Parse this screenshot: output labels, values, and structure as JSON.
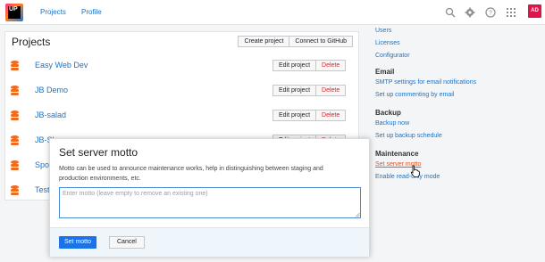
{
  "logo": {
    "text": "UP"
  },
  "nav": {
    "projects": "Projects",
    "profile": "Profile"
  },
  "header_icons": [
    "search-icon",
    "gear-icon",
    "help-icon",
    "apps-grid-icon"
  ],
  "user": {
    "initials": "AD"
  },
  "projects_panel": {
    "title": "Projects",
    "create_label": "Create project",
    "connect_label": "Connect to GitHub",
    "edit_label": "Edit project",
    "delete_label": "Delete",
    "rows": [
      {
        "name": "Easy Web Dev"
      },
      {
        "name": "JB Demo"
      },
      {
        "name": "JB-salad"
      },
      {
        "name": "JB-Show"
      },
      {
        "name": "Spo"
      },
      {
        "name": "Test"
      }
    ]
  },
  "sidebar": {
    "users": "Users",
    "licenses": "Licenses",
    "configurator": "Configurator",
    "email_head": "Email",
    "smtp": "SMTP settings for email notifications",
    "commenting": "Set up commenting by email",
    "backup_head": "Backup",
    "backup_now": "Backup now",
    "backup_schedule": "Set up backup schedule",
    "maintenance_head": "Maintenance",
    "server_motto": "Set server motto",
    "read_only": "Enable read-only mode"
  },
  "modal": {
    "title": "Set server motto",
    "description": "Motto can be used to announce maintenance works, help in distinguishing between staging and production environments, etc.",
    "placeholder": "Enter motto (leave empty to remove an existing one)",
    "value": "",
    "submit_label": "Set motto",
    "cancel_label": "Cancel"
  },
  "colors": {
    "link": "#1a73c8",
    "danger": "#d8262c",
    "active_link": "#e0542b",
    "primary": "#1a73e8",
    "db_icon": "#f26b1d"
  }
}
